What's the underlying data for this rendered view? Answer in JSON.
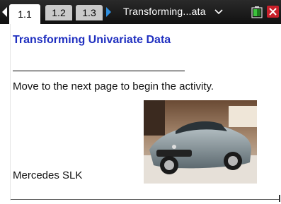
{
  "tabs": [
    {
      "label": "1.1",
      "active": true
    },
    {
      "label": "1.2",
      "active": false
    },
    {
      "label": "1.3",
      "active": false
    }
  ],
  "document": {
    "title": "Transforming...ata"
  },
  "icons": {
    "prev_page": "left-arrow-icon",
    "next_page": "right-arrow-icon",
    "menu": "chevron-down-icon",
    "battery": "battery-icon",
    "close": "close-icon"
  },
  "colors": {
    "heading": "#2030c0",
    "next_arrow": "#2e8fe0",
    "battery": "#3cc23c",
    "close": "#c8202a"
  },
  "page": {
    "heading": "Transforming Univariate Data",
    "instruction": "Move to the next page to begin the activity.",
    "caption": "Mercedes SLK"
  }
}
